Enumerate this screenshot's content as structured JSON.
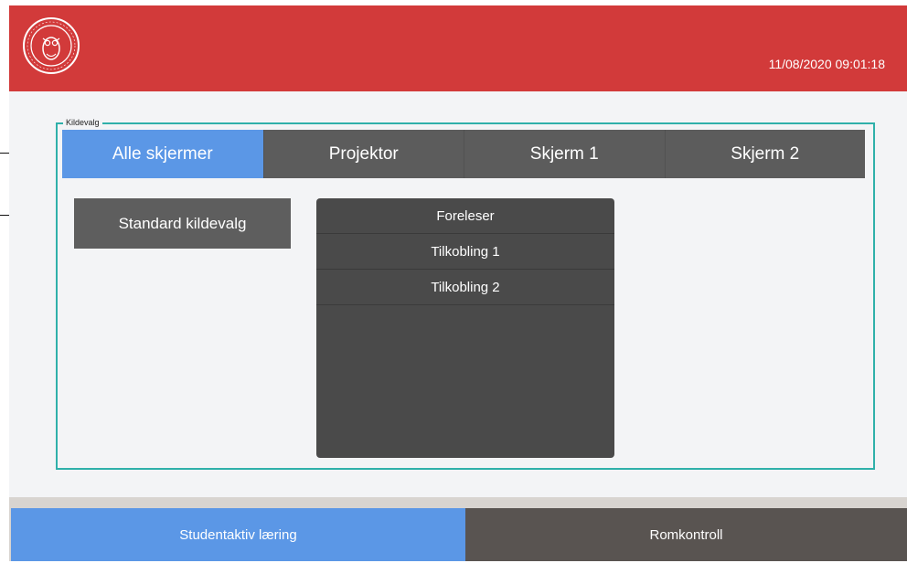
{
  "header": {
    "datetime": "11/08/2020 09:01:18",
    "logo_icon": "university-seal-logo",
    "background_color": "#d23a3a"
  },
  "source_group": {
    "legend": "Kildevalg",
    "tabs": [
      {
        "label": "Alle skjermer",
        "active": true
      },
      {
        "label": "Projektor",
        "active": false
      },
      {
        "label": "Skjerm 1",
        "active": false
      },
      {
        "label": "Skjerm 2",
        "active": false
      }
    ],
    "standard_button_label": "Standard kildevalg",
    "sources": [
      {
        "label": "Foreleser"
      },
      {
        "label": "Tilkobling 1"
      },
      {
        "label": "Tilkobling 2"
      }
    ]
  },
  "footer": {
    "left_label": "Studentaktiv læring",
    "right_label": "Romkontroll"
  },
  "colors": {
    "accent_blue": "#5b97e6",
    "dark_gray": "#5c5c5c",
    "teal_border": "#2fb0aa"
  }
}
